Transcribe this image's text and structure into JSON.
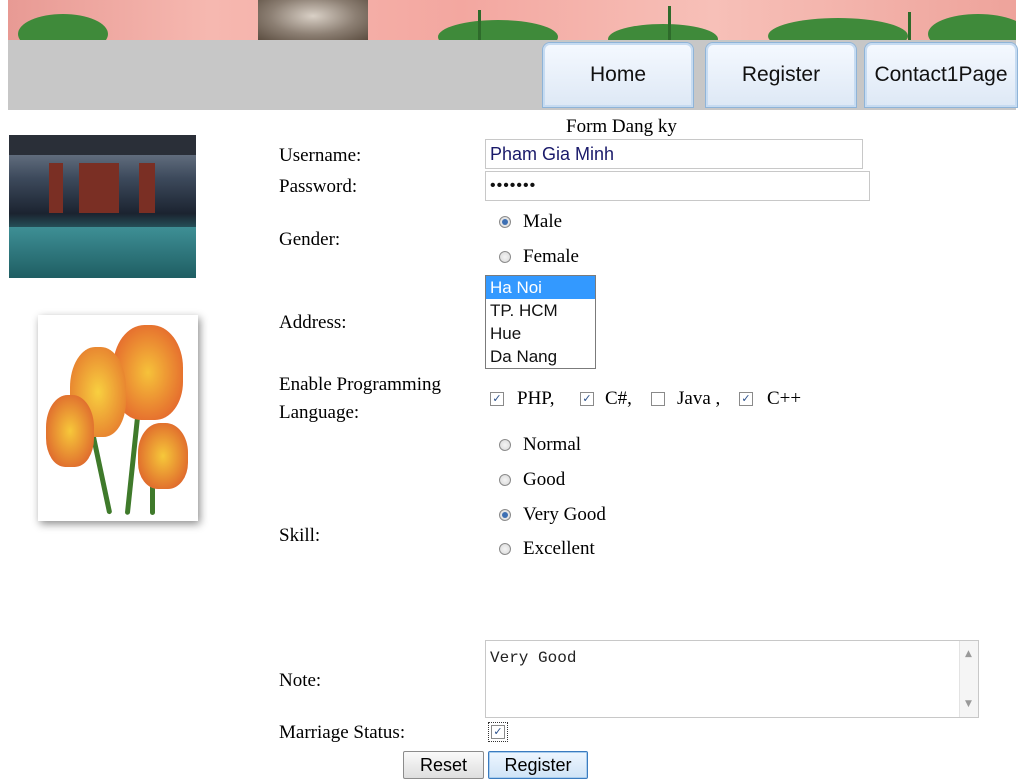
{
  "nav": {
    "tabs": [
      "Home",
      "Register",
      "Contact1Page"
    ]
  },
  "form": {
    "title": "Form Dang ky",
    "username_label": "Username:",
    "username_value": "Pham Gia Minh",
    "password_label": "Password:",
    "password_value": "•••••••",
    "gender_label": "Gender:",
    "gender_options": [
      "Male",
      "Female"
    ],
    "gender_selected": "Male",
    "address_label": "Address:",
    "address_options": [
      "Ha Noi",
      "TP. HCM",
      "Hue",
      "Da Nang"
    ],
    "address_selected": "Ha Noi",
    "language_label_line1": "Enable Programming",
    "language_label_line2": "Language:",
    "languages": [
      {
        "label": "PHP,",
        "checked": true
      },
      {
        "label": "C#,",
        "checked": true
      },
      {
        "label": "Java ,",
        "checked": false
      },
      {
        "label": "C++",
        "checked": true
      }
    ],
    "skill_label": "Skill:",
    "skill_options": [
      "Normal",
      "Good",
      "Very Good",
      "Excellent"
    ],
    "skill_selected": "Very Good",
    "note_label": "Note:",
    "note_value": "Very Good",
    "marriage_label": "Marriage Status:",
    "marriage_checked": true,
    "reset_label": "Reset",
    "register_label": "Register"
  },
  "icons": {
    "check": "✓",
    "scroll_up": "▲",
    "scroll_down": "▼"
  },
  "colors": {
    "nav_bg": "#c7c7c7",
    "list_selected": "#3399ff",
    "radio_dot": "#3d6fb3"
  }
}
